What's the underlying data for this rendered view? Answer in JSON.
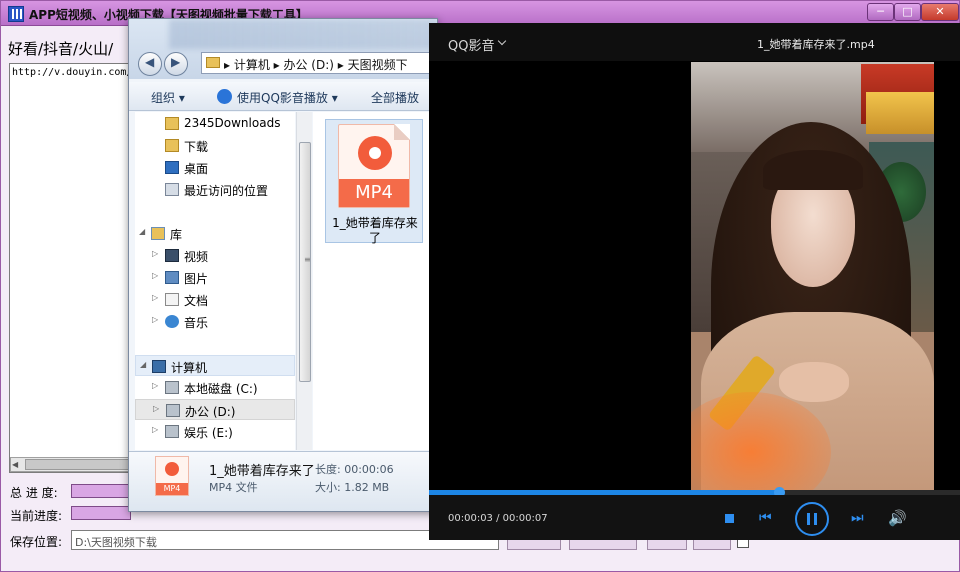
{
  "app": {
    "title": "APP短视频、小视频下载【天图视频批量下载工具】",
    "window_buttons": {
      "minimize": "─",
      "maximize": "□",
      "close": "✕"
    },
    "link_label": "好看/抖音/火山/",
    "url_text": "http://v.douyin.com/",
    "total_progress_label": "总 进 度:",
    "current_progress_label": "当前进度:",
    "total_progress": 1.0,
    "current_progress": 1.0,
    "save_location_label": "保存位置:",
    "save_location_value": "D:\\天图视频下载",
    "accent_color": "#b86fc8"
  },
  "explorer": {
    "nav_back_icon": "back-arrow-icon",
    "nav_forward_icon": "forward-arrow-icon",
    "address_path": "▸ 计算机 ▸ 办公 (D:) ▸ 天图视频下",
    "toolbar": {
      "organize": "组织 ▾",
      "play_with_qq": "使用QQ影音播放 ▾",
      "play_all": "全部播放"
    },
    "nav_items": [
      {
        "label": "2345Downloads",
        "icon": "folder-icon"
      },
      {
        "label": "下载",
        "icon": "download-folder-icon"
      },
      {
        "label": "桌面",
        "icon": "desktop-icon"
      },
      {
        "label": "最近访问的位置",
        "icon": "recent-places-icon"
      },
      {
        "label": "库",
        "icon": "library-icon"
      },
      {
        "label": "视频",
        "icon": "video-library-icon"
      },
      {
        "label": "图片",
        "icon": "pictures-library-icon"
      },
      {
        "label": "文档",
        "icon": "documents-library-icon"
      },
      {
        "label": "音乐",
        "icon": "music-library-icon"
      },
      {
        "label": "计算机",
        "icon": "computer-icon"
      },
      {
        "label": "本地磁盘 (C:)",
        "icon": "drive-c-icon"
      },
      {
        "label": "办公 (D:)",
        "icon": "drive-d-icon"
      },
      {
        "label": "娱乐 (E:)",
        "icon": "drive-e-icon"
      }
    ],
    "file": {
      "icon_badge": "MP4",
      "name": "1_她带着库存来了"
    },
    "details": {
      "name": "1_她带着库存来了",
      "type": "MP4 文件",
      "length": "长度: 00:00:06",
      "size": "大小: 1.82 MB"
    }
  },
  "player": {
    "brand": "QQ影音",
    "file_name": "1_她带着库存来了.mp4",
    "time": "00:00:03 / 00:00:07",
    "progress": 0.66,
    "accent_color": "#2e8ef0",
    "controls": {
      "stop": "stop-icon",
      "prev": "⏮",
      "pause": "pause-icon",
      "next": "⏭",
      "volume": "🔊"
    }
  }
}
